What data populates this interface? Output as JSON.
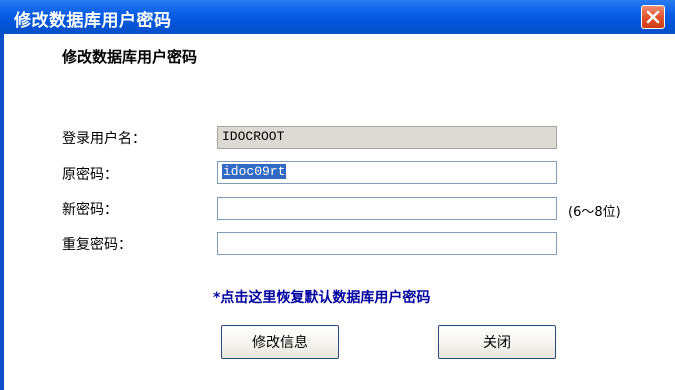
{
  "window": {
    "title": "修改数据库用户密码",
    "close_icon": "close-icon"
  },
  "form": {
    "heading": "修改数据库用户密码",
    "login_user_label": "登录用户名：",
    "login_user_value": "IDOCROOT",
    "old_password_label": "原密码：",
    "old_password_value": "idoc09rt",
    "new_password_label": "新密码：",
    "new_password_value": "",
    "new_password_hint": "(6～8位)",
    "repeat_password_label": "重复密码：",
    "repeat_password_value": ""
  },
  "restore_link": "*点击这里恢复默认数据库用户密码",
  "buttons": {
    "modify_label": "修改信息",
    "close_label": "关闭"
  },
  "colors": {
    "titlebar": "#0a5ee6",
    "close_button": "#e0532c",
    "selection": "#316ac5",
    "link": "#0000a0"
  }
}
